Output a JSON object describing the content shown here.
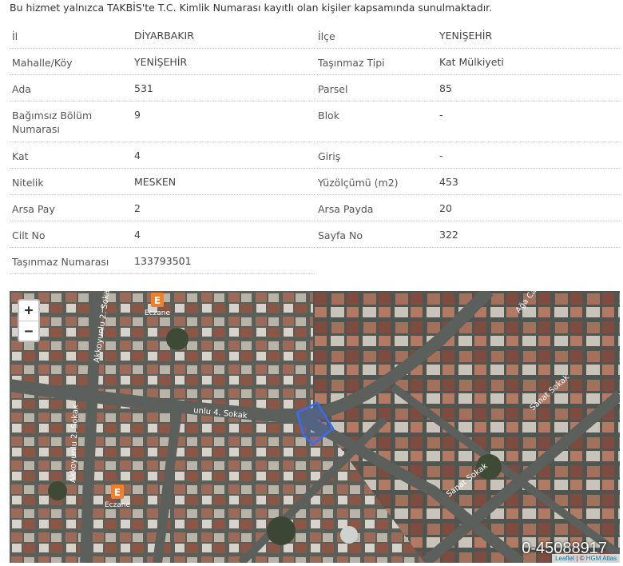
{
  "notice": "Bu hizmet yalnızca TAKBİS'te T.C. Kimlik Numarası kayıtlı olan kişiler kapsamında sunulmaktadır.",
  "fields": {
    "il": {
      "label": "İl",
      "value": "DİYARBAKIR"
    },
    "ilce": {
      "label": "İlçe",
      "value": "YENİŞEHİR"
    },
    "mahalle": {
      "label": "Mahalle/Köy",
      "value": "YENİŞEHİR"
    },
    "tasinmaz_tipi": {
      "label": "Taşınmaz Tipi",
      "value": "Kat Mülkiyeti"
    },
    "ada": {
      "label": "Ada",
      "value": "531"
    },
    "parsel": {
      "label": "Parsel",
      "value": "85"
    },
    "bagimsiz_bolum": {
      "label": "Bağımsız Bölüm Numarası",
      "value": "9"
    },
    "blok": {
      "label": "Blok",
      "value": "-"
    },
    "kat": {
      "label": "Kat",
      "value": "4"
    },
    "giris": {
      "label": "Giriş",
      "value": "-"
    },
    "nitelik": {
      "label": "Nitelik",
      "value": "MESKEN"
    },
    "yuzolcumu": {
      "label": "Yüzölçümü (m2)",
      "value": "453"
    },
    "arsa_pay": {
      "label": "Arsa Pay",
      "value": "2"
    },
    "arsa_payda": {
      "label": "Arsa Payda",
      "value": "20"
    },
    "cilt_no": {
      "label": "Cilt No",
      "value": "4"
    },
    "sayfa_no": {
      "label": "Sayfa No",
      "value": "322"
    },
    "tasinmaz_numarasi": {
      "label": "Taşınmaz Numarası",
      "value": "133793501"
    }
  },
  "map": {
    "zoom_in": "+",
    "zoom_out": "−",
    "parcel_id": "0-45088917",
    "attribution_leaflet": "Leaflet",
    "attribution_sep": " | © ",
    "attribution_hgm": "HGM Atlas",
    "streets": {
      "s1": "Akkoyunlu 2. Sokak",
      "s2": "Akkoyunlu 2. Sokak",
      "s3": "unlu 4. Sokak",
      "s4": "Sanat Sokak",
      "s5": "Sanat Sokak",
      "s6": "Ağa Caddesi"
    },
    "poi_label": "Eczane",
    "poi_icon": "E",
    "colors": {
      "parcel": "#3a6cf0",
      "poi": "#f07f2a"
    }
  }
}
